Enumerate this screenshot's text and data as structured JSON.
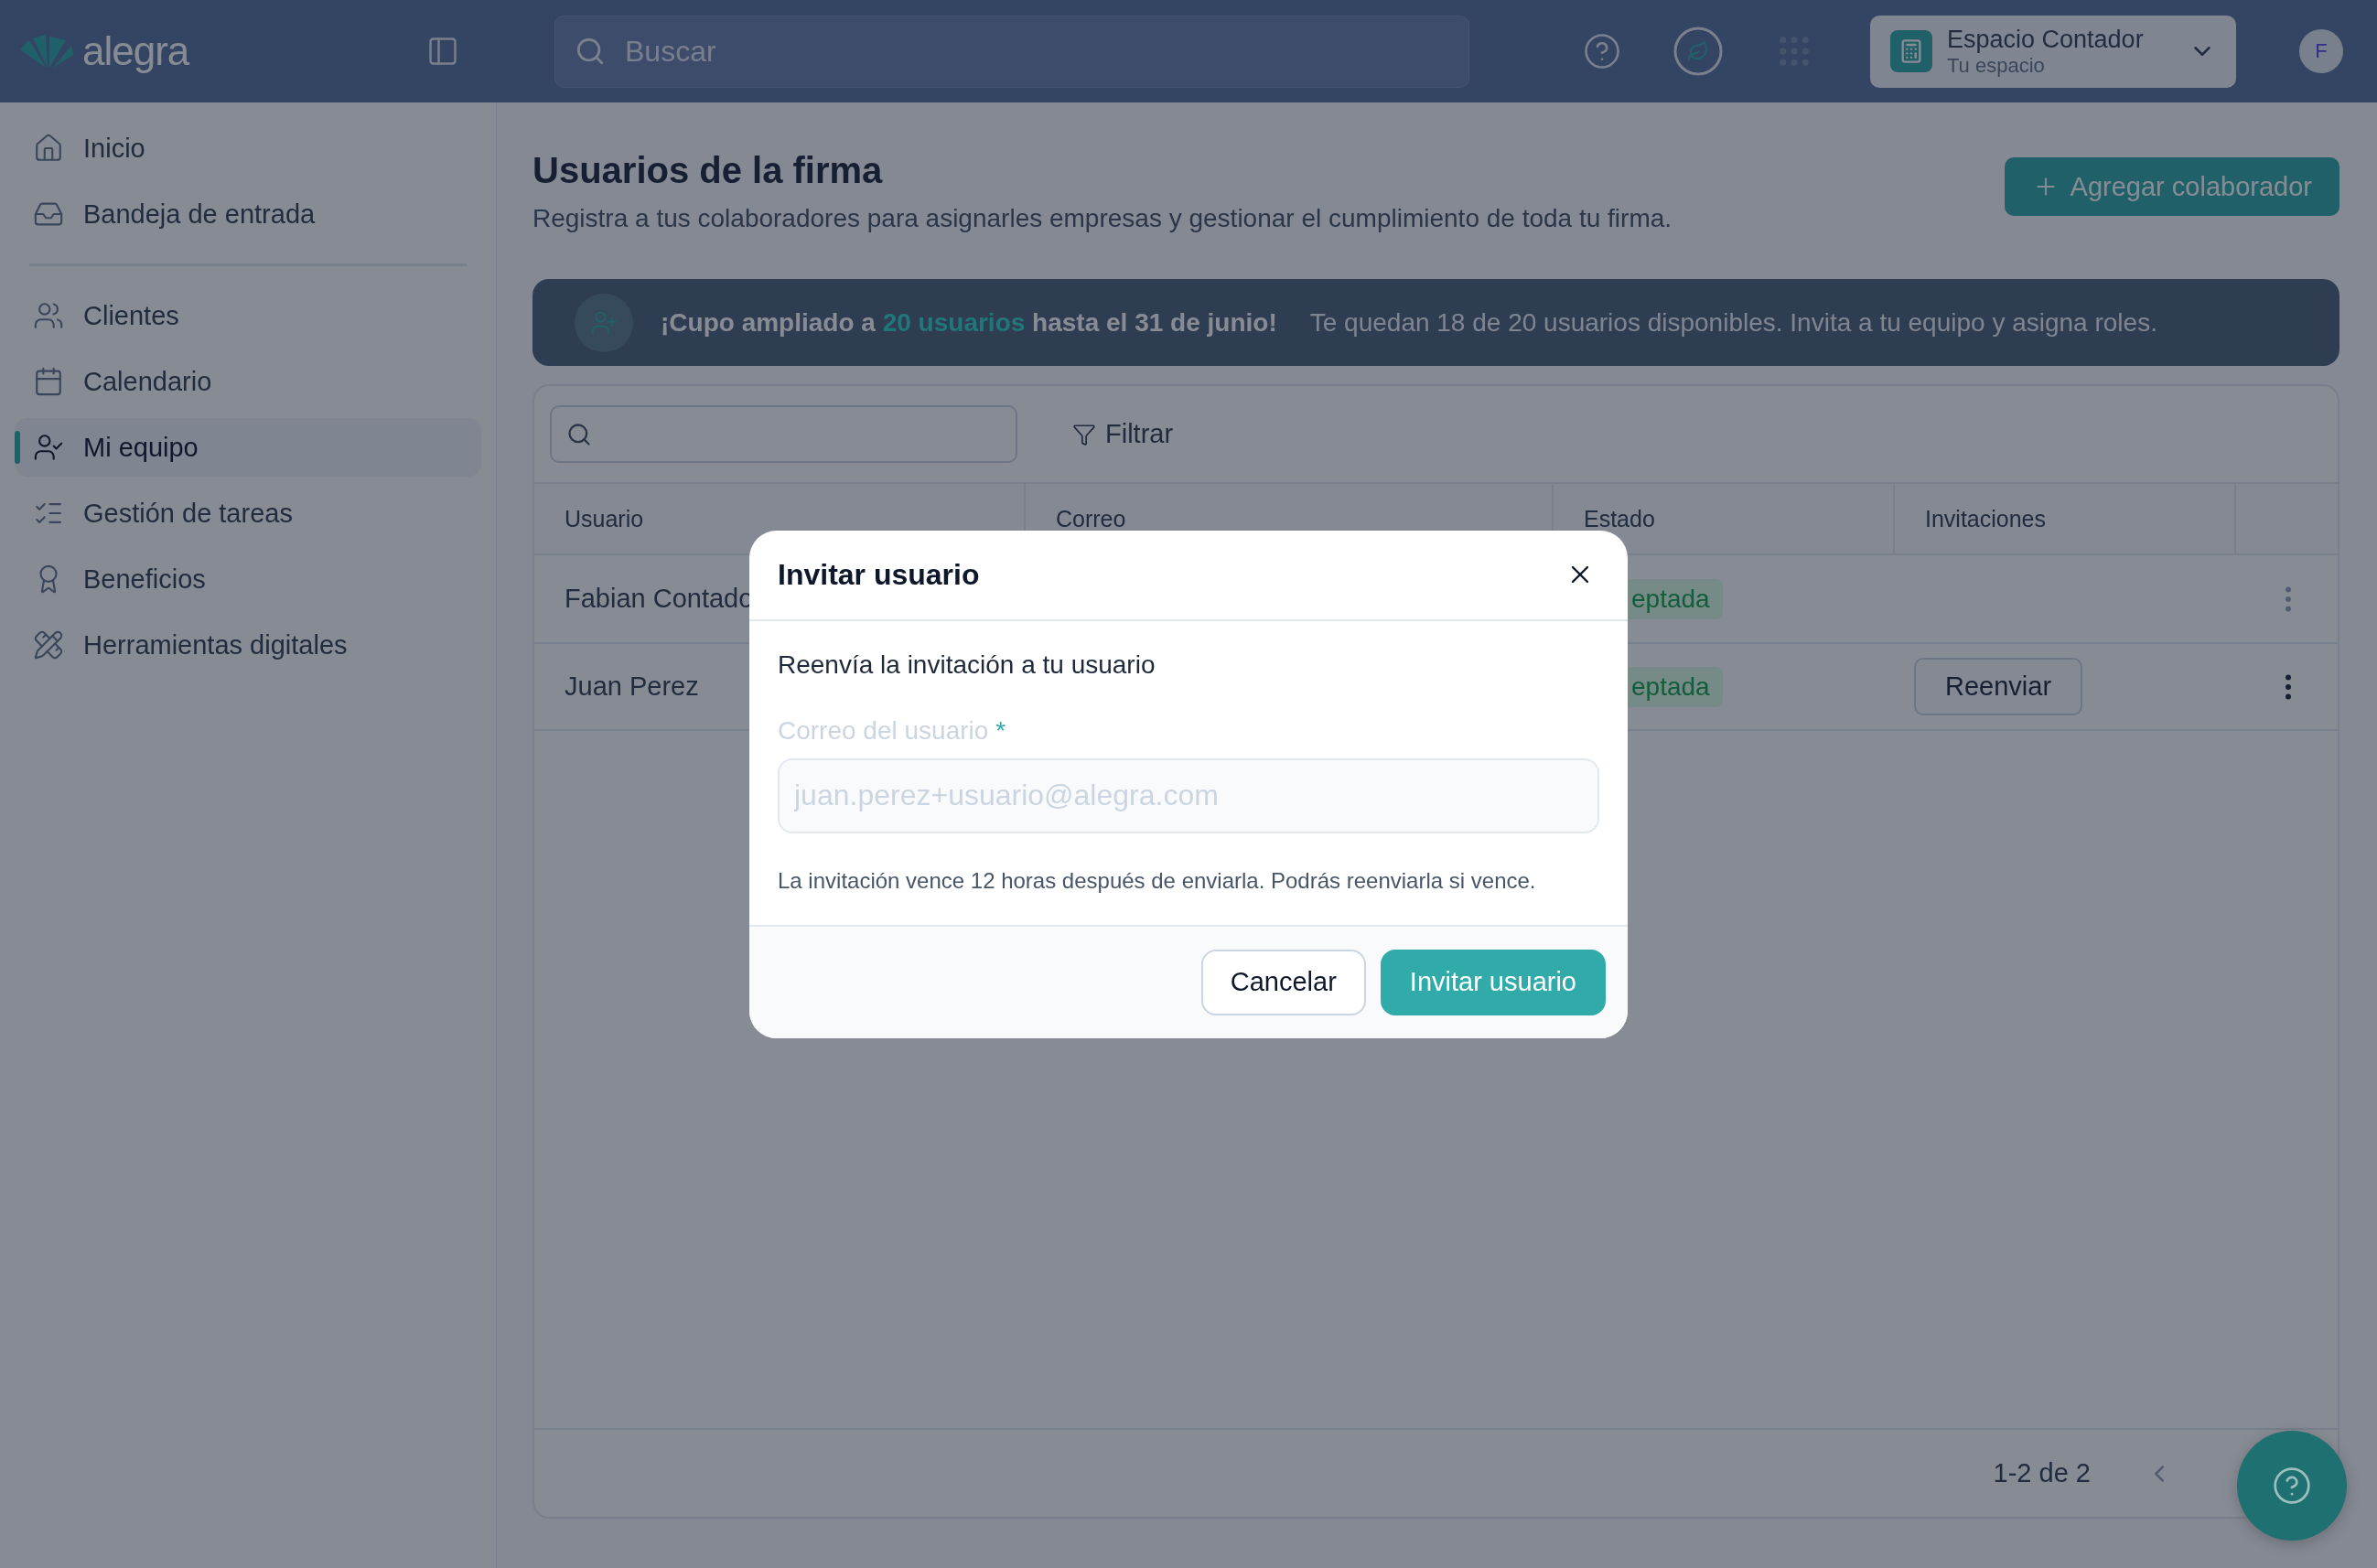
{
  "topbar": {
    "logo": "alegra",
    "search": {
      "placeholder": "Buscar"
    },
    "workspace": {
      "title": "Espacio Contador",
      "subtitle": "Tu espacio"
    },
    "avatar": "F"
  },
  "sidebar": {
    "groups": [
      [
        {
          "label": "Inicio",
          "selected": false
        },
        {
          "label": "Bandeja de entrada",
          "selected": false
        }
      ],
      [
        {
          "label": "Clientes",
          "selected": false
        },
        {
          "label": "Calendario",
          "selected": false
        },
        {
          "label": "Mi equipo",
          "selected": true
        },
        {
          "label": "Gestión de tareas",
          "selected": false
        },
        {
          "label": "Beneficios",
          "selected": false
        },
        {
          "label": "Herramientas digitales",
          "selected": false
        }
      ]
    ]
  },
  "page": {
    "title": "Usuarios de la firma",
    "subtitle": "Registra a tus colaboradores para asignarles empresas y gestionar el cumplimiento de toda tu firma.",
    "add_button": "Agregar colaborador"
  },
  "banner": {
    "headline": {
      "before": "¡Cupo ampliado a ",
      "highlight": "20 usuarios",
      "after": " hasta el 31 de junio!"
    },
    "detail": "Te quedan 18 de 20 usuarios disponibles. Invita a tu equipo y asigna roles."
  },
  "table": {
    "filter": "Filtrar",
    "columns": [
      "Usuario",
      "Correo",
      "Estado",
      "Invitaciones"
    ],
    "rows": [
      {
        "user": "Fabian Contado",
        "status": "eptada",
        "action": null,
        "menu_enabled": false
      },
      {
        "user": "Juan Perez",
        "status": "eptada",
        "action": "Reenviar",
        "menu_enabled": true
      }
    ],
    "pagination": "1-2 de 2"
  },
  "modal": {
    "title": "Invitar usuario",
    "description": "Reenvía la invitación a tu usuario",
    "field": {
      "label": "Correo del usuario",
      "required_mark": "*",
      "placeholder": "juan.perez+usuario@alegra.com",
      "disabled": true
    },
    "hint": "La invitación vence 12 horas después de enviarla. Podrás reenviarla si vence.",
    "buttons": [
      {
        "label": "Cancelar",
        "kind": "secondary"
      },
      {
        "label": "Invitar usuario",
        "kind": "primary"
      }
    ]
  }
}
